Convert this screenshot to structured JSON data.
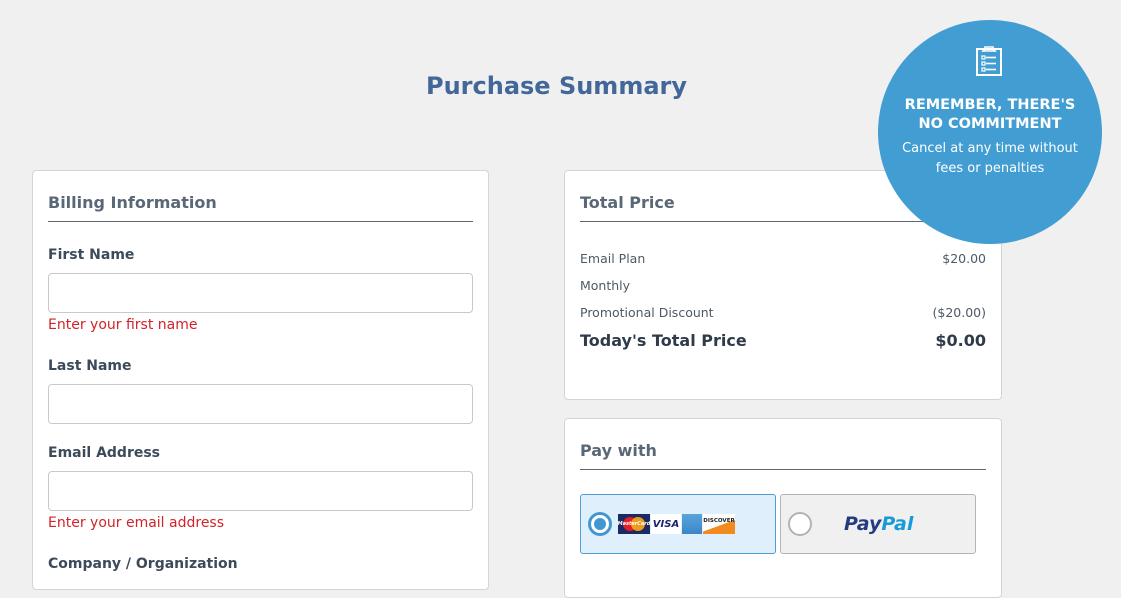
{
  "page": {
    "title": "Purchase Summary"
  },
  "badge": {
    "icon": "clipboard-list-icon",
    "title_line1": "REMEMBER, THERE'S",
    "title_line2": "NO COMMITMENT",
    "text_line1": "Cancel at any time without",
    "text_line2": "fees or penalties",
    "color": "#429dd3"
  },
  "billing": {
    "heading": "Billing Information",
    "fields": [
      {
        "label": "First Name",
        "value": "",
        "placeholder": "",
        "error": "Enter your first name"
      },
      {
        "label": "Last Name",
        "value": "",
        "placeholder": "",
        "error": ""
      },
      {
        "label": "Email Address",
        "value": "",
        "placeholder": "",
        "error": "Enter your email address"
      },
      {
        "label": "Company / Organization",
        "value": "",
        "placeholder": "",
        "error": ""
      }
    ]
  },
  "total_price": {
    "heading": "Total Price",
    "rows": [
      {
        "label": "Email Plan",
        "value": "$20.00"
      },
      {
        "label": "Monthly",
        "value": ""
      },
      {
        "label": "Promotional Discount",
        "value": "($20.00)"
      }
    ],
    "total": {
      "label": "Today's Total Price",
      "value": "$0.00"
    }
  },
  "pay_with": {
    "heading": "Pay with",
    "options": [
      {
        "id": "card",
        "selected": true,
        "logos": [
          "MasterCard",
          "VISA",
          "American Express",
          "DISCOVER"
        ]
      },
      {
        "id": "paypal",
        "selected": false,
        "logo_part1": "Pay",
        "logo_part2": "Pal"
      }
    ]
  },
  "colors": {
    "title": "#44679a",
    "error": "#d1232a",
    "accent": "#4297d3",
    "selected_bg": "#dff0fc"
  }
}
